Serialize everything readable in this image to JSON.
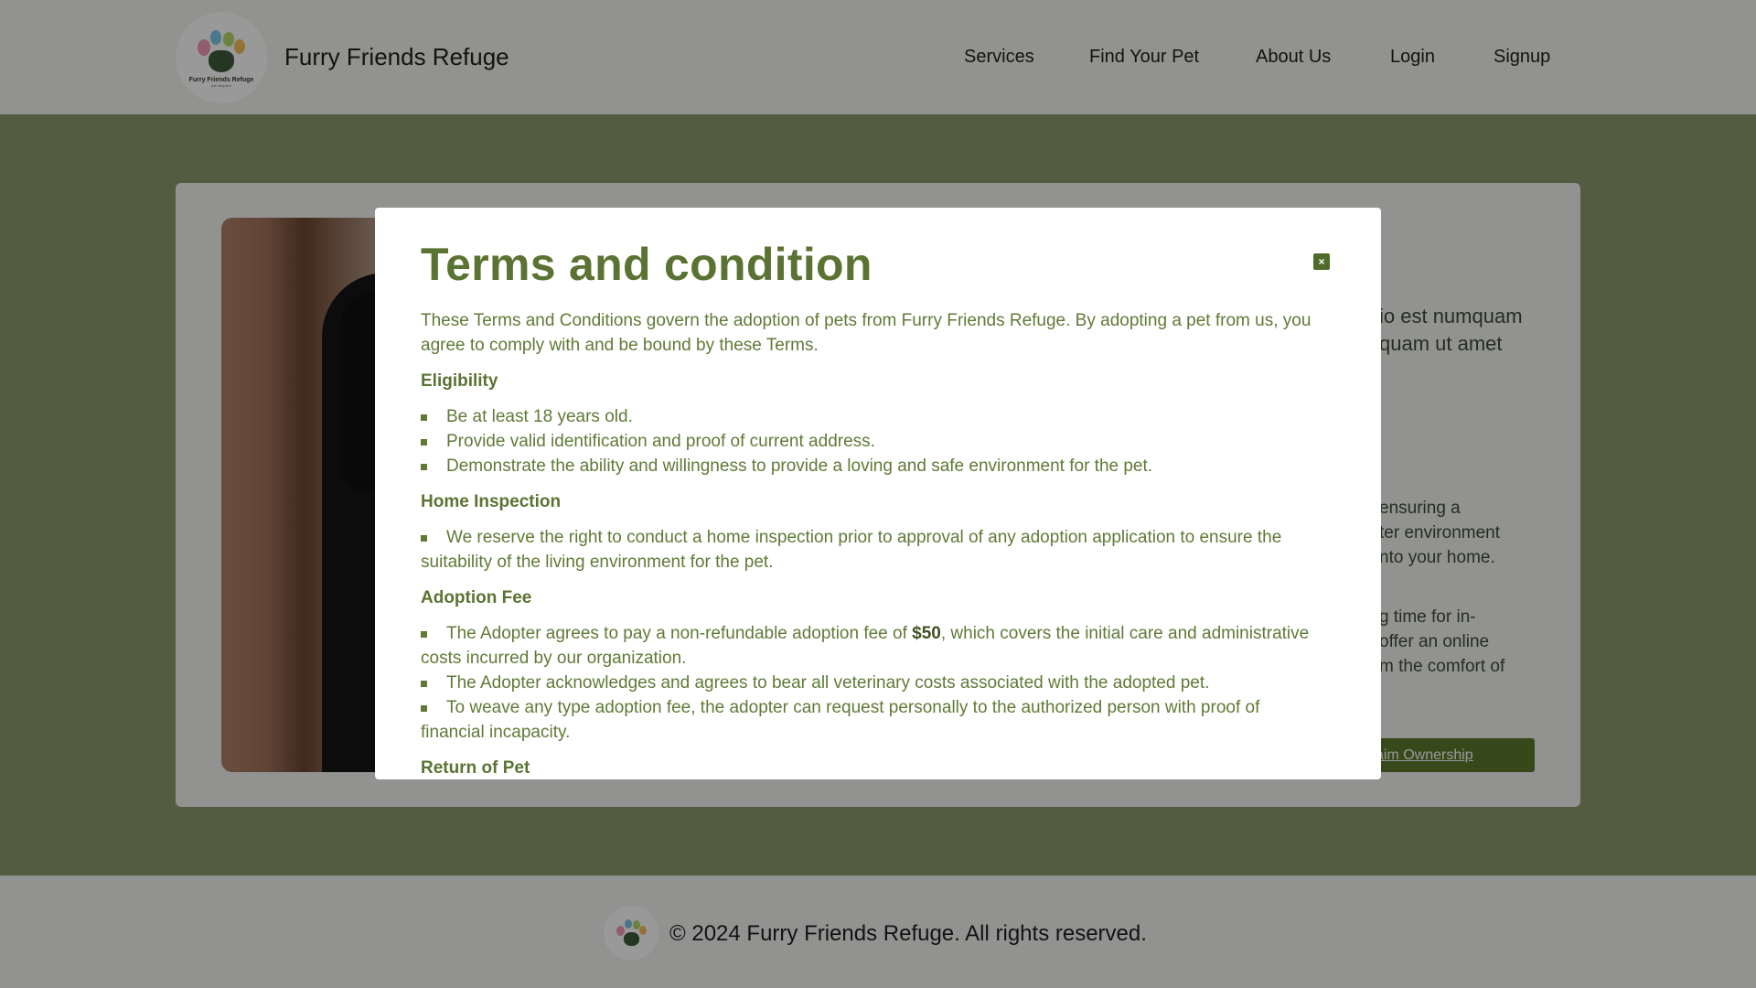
{
  "header": {
    "brand": "Furry Friends Refuge",
    "logo_caption": "Furry Friends Refuge",
    "logo_subcaption": "pet adoption",
    "nav": [
      "Services",
      "Find Your Pet",
      "About Us",
      "Login",
      "Signup"
    ]
  },
  "background": {
    "line1": "io est numquam",
    "line2": "quam ut amet",
    "line3": "ensuring a",
    "line4": "ter environment",
    "line5": "nto your home.",
    "line6": "g time for in-",
    "line7": "offer an online",
    "line8": "m the comfort of",
    "claim_button": "aim Ownership"
  },
  "modal": {
    "title": "Terms and condition",
    "close_icon": "×",
    "intro": "These Terms and Conditions govern the adoption of pets from Furry Friends Refuge. By adopting a pet from us, you agree to comply with and be bound by these Terms.",
    "sections": [
      {
        "heading": "Eligibility",
        "items": [
          "Be at least 18 years old.",
          "Provide valid identification and proof of current address.",
          "Demonstrate the ability and willingness to provide a loving and safe environment for the pet."
        ]
      },
      {
        "heading": "Home Inspection",
        "items": [
          "We reserve the right to conduct a home inspection prior to approval of any adoption application to ensure the suitability of the living environment for the pet."
        ]
      },
      {
        "heading": "Adoption Fee",
        "fee_prefix": "The Adopter agrees to pay a non-refundable adoption fee of ",
        "fee_amount": "$50",
        "fee_suffix": ", which covers the initial care and administrative costs incurred by our organization.",
        "items": [
          "The Adopter acknowledges and agrees to bear all veterinary costs associated with the adopted pet.",
          "To weave any type adoption fee, the adopter can request personally to the authorized person with proof of financial incapacity."
        ]
      },
      {
        "heading": "Return of Pet"
      }
    ]
  },
  "footer": {
    "copyright": "© 2024 Furry Friends Refuge. All rights reserved."
  }
}
